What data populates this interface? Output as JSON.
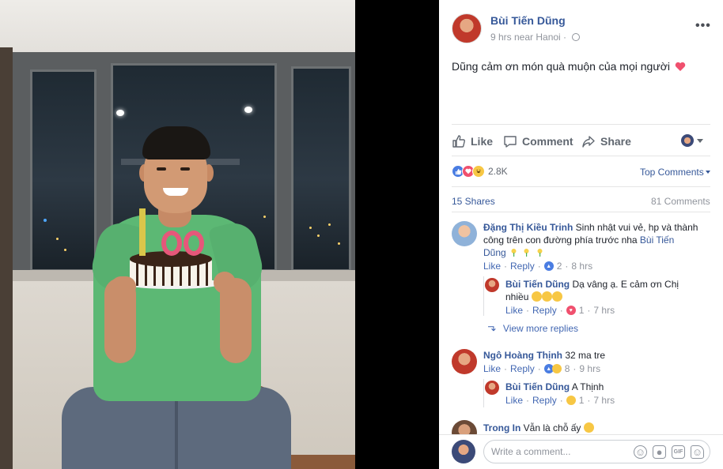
{
  "post": {
    "author": "Bùi Tiến Dũng",
    "meta": "9 hrs near Hanoi ·",
    "text": "Dũng cảm ơn món quà muộn của mọi người",
    "more_label": "•••"
  },
  "actions": {
    "like": "Like",
    "comment": "Comment",
    "share": "Share"
  },
  "reactions": {
    "count": "2.8K",
    "top_comments": "Top Comments",
    "shares": "15 Shares",
    "comments": "81 Comments"
  },
  "comments": [
    {
      "name": "Đặng Thị Kiều Trinh",
      "text_line1": " Sinh nhật vui vẻ, hp và thành",
      "text_line2": "công trên con đường phía trước nha ",
      "mention": "Bùi Tiến",
      "mention2": "Dũng",
      "like": "Like",
      "reply": "Reply",
      "react_count": "2",
      "time": "8 hrs"
    },
    {
      "name": "Bùi Tiến Dũng",
      "text_line1": " Dạ vâng ạ. E cảm ơn Chị",
      "text_line2": "nhiều",
      "like": "Like",
      "reply": "Reply",
      "react_count": "1",
      "time": "7 hrs"
    },
    {
      "view_more": "View more replies"
    },
    {
      "name": "Ngô Hoàng Thịnh",
      "text": " 32 ma tre",
      "like": "Like",
      "reply": "Reply",
      "react_count": "8",
      "time": "9 hrs"
    },
    {
      "name": "Bùi Tiến Dũng",
      "text": " A Thịnh",
      "like": "Like",
      "reply": "Reply",
      "react_count": "1",
      "time": "7 hrs"
    },
    {
      "name": "Trong In",
      "text": " Vẫn là chỗ ấy"
    }
  ],
  "composer": {
    "placeholder": "Write a comment..."
  },
  "colors": {
    "link": "#365899",
    "like_blue": "#4a7de2",
    "love_red": "#f0506e",
    "haha_yellow": "#f7c744"
  }
}
